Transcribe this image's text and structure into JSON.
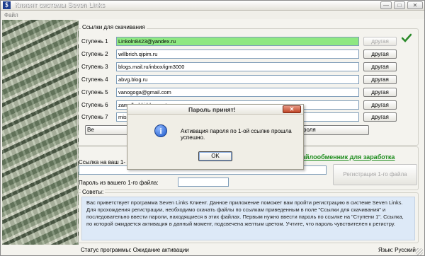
{
  "window": {
    "title": "Клиент системы Seven Links",
    "icon_label": "$",
    "minimize_glyph": "—",
    "maximize_glyph": "□",
    "close_glyph": "✕"
  },
  "menu": {
    "file": "Файл"
  },
  "links_group": {
    "legend": "Ссылки для скачивания",
    "steps": [
      {
        "label": "Ступень 1",
        "value": "Linkoln8423@yandex.ru",
        "active": true,
        "button": "другая",
        "button_enabled": false
      },
      {
        "label": "Ступень 2",
        "value": "willbrich.qipim.ru",
        "active": false,
        "button": "другая",
        "button_enabled": true
      },
      {
        "label": "Ступень 3",
        "value": "blogs.mail.ru/inbox/igm3000",
        "active": false,
        "button": "другая",
        "button_enabled": true
      },
      {
        "label": "Ступень 4",
        "value": "abvg.blog.ru",
        "active": false,
        "button": "другая",
        "button_enabled": true
      },
      {
        "label": "Ступень 5",
        "value": "vanogoga@gmail.com",
        "active": false,
        "button": "другая",
        "button_enabled": true
      },
      {
        "label": "Ступень 6",
        "value": "zamulbabki.blogspot.com",
        "active": false,
        "button": "другая",
        "button_enabled": true
      },
      {
        "label": "Ступень 7",
        "value": "mis",
        "active": false,
        "button": "другая",
        "button_enabled": true
      }
    ],
    "hidden_button_left": "Ве",
    "hidden_button_right": "роля"
  },
  "registration": {
    "link_label": "Ссылка на ваш 1-",
    "link_value": "",
    "password_label": "Пароль из вашего 1-го файла:",
    "password_value": "",
    "file_host_link": "айлообменник для заработка",
    "register_button": "Регистрация 1-го файла"
  },
  "advice": {
    "legend": "Советы:",
    "text": "Вас приветствует программа Seven Links Клиент. Данное приложение поможет вам пройти регистрацию в системе Seven Links. Для прохождения регистрации, необходимо скачать файлы по ссылкам приведенным в поле \"Ссылки для скачивания\" и последовательно ввести пароли, находящиеся в этих файлах. Первым нужно ввести пароль по ссылке на \"Ступени 1\". Ссылка, по которой ожидается активация в данный момент, подсвечена желтым цветом. Учтите, что пароль чувствителен к регистру."
  },
  "status": {
    "program_status": "Статус программы: Ожидание активации",
    "language": "Язык: Русский"
  },
  "dialog": {
    "title": "Пароль принят!",
    "message": "Активация пароля по 1-ой ссылке прошла успешно.",
    "ok_label": "OK",
    "close_glyph": "✕",
    "info_glyph": "i"
  },
  "colors": {
    "active_field": "#8ee882",
    "link_green": "#1c8c1c",
    "advice_bg": "#dde9f7"
  }
}
